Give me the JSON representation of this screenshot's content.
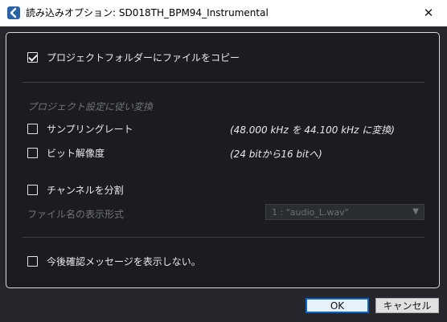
{
  "window": {
    "title": "読み込みオプション: SD018TH_BPM94_Instrumental",
    "app_icon": "cubase-app-icon",
    "close_glyph": "✕"
  },
  "options": {
    "copy_to_project": {
      "label": "プロジェクトフォルダーにファイルをコピー",
      "checked": true
    },
    "convert_section": "プロジェクト設定に従い変換",
    "sample_rate": {
      "label": "サンプリングレート",
      "checked": false,
      "info": "(48.000 kHz を 44.100 kHz に変換)"
    },
    "bit_depth": {
      "label": "ビット解像度",
      "checked": false,
      "info": "(24 bitから16 bitへ)"
    },
    "split_channels": {
      "label": "チャンネルを分割",
      "checked": false
    },
    "filename_format": {
      "label": "ファイル名の表示形式",
      "value": "1 : \"audio_L.wav\""
    },
    "dont_show_again": {
      "label": "今後確認メッセージを表示しない。",
      "checked": false
    }
  },
  "buttons": {
    "ok": "OK",
    "cancel": "キャンセル"
  },
  "colors": {
    "background": "#25272c",
    "panel": "#1a1c20",
    "ok_border": "#0b62c6"
  }
}
